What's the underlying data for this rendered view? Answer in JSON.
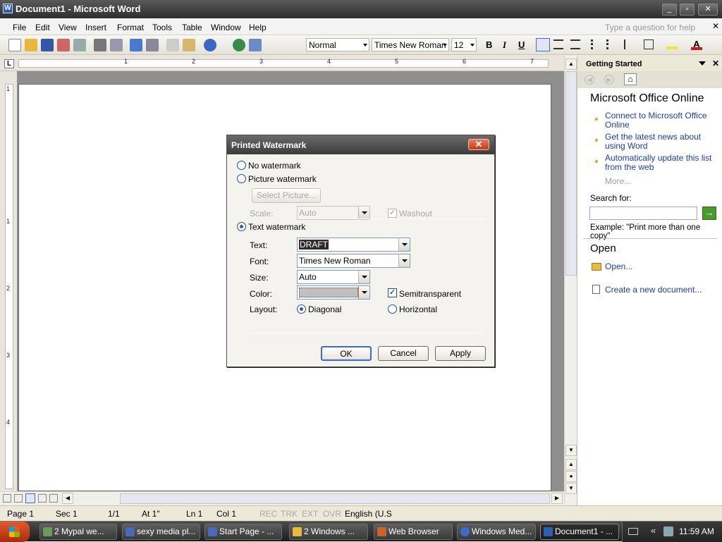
{
  "window": {
    "title": "Document1 - Microsoft Word",
    "icon": "word-doc-icon",
    "minimize": "_",
    "maximize": "▫",
    "close": "✕"
  },
  "menu": {
    "items": [
      "File",
      "Edit",
      "View",
      "Insert",
      "Format",
      "Tools",
      "Table",
      "Window",
      "Help"
    ],
    "help_placeholder": "Type a question for help"
  },
  "toolbar": {
    "style": "Normal",
    "font": "Times New Roman",
    "size": "12",
    "bold": "B",
    "italic": "I",
    "underline": "U"
  },
  "ruler": {
    "corner": "L",
    "numbers": [
      "1",
      "2",
      "3",
      "4",
      "5",
      "6",
      "7"
    ],
    "vertical_numbers": [
      "1",
      "1",
      "2",
      "3",
      "4"
    ]
  },
  "taskpane": {
    "title": "Getting Started",
    "heading_online": "Microsoft Office Online",
    "links": [
      "Connect to Microsoft Office Online",
      "Get the latest news about using Word",
      "Automatically update this list from the web"
    ],
    "more": "More...",
    "search_label": "Search for:",
    "search_value": "",
    "example": "Example:  \"Print more than one copy\"",
    "heading_open": "Open",
    "open_link": "Open...",
    "create_link": "Create a new document..."
  },
  "dialog": {
    "title": "Printed Watermark",
    "close": "✕",
    "no_watermark": "No watermark",
    "picture_watermark": "Picture watermark",
    "select_picture": "Select Picture...",
    "scale_label": "Scale:",
    "scale_value": "Auto",
    "washout": "Washout",
    "text_watermark": "Text watermark",
    "text_label": "Text:",
    "text_value": "DRAFT",
    "font_label": "Font:",
    "font_value": "Times New Roman",
    "size_label": "Size:",
    "size_value": "Auto",
    "color_label": "Color:",
    "semitransparent": "Semitransparent",
    "layout_label": "Layout:",
    "diagonal": "Diagonal",
    "horizontal": "Horizontal",
    "ok": "OK",
    "cancel": "Cancel",
    "apply": "Apply",
    "selected": "text_watermark",
    "layout_selected": "diagonal",
    "semitransparent_checked": true,
    "washout_checked": true
  },
  "status": {
    "page": "Page  1",
    "sec": "Sec  1",
    "pages": "1/1",
    "at": "At  1\"",
    "ln": "Ln  1",
    "col": "Col  1",
    "rec": "REC",
    "trk": "TRK",
    "ext": "EXT",
    "ovr": "OVR",
    "lang": "English (U.S"
  },
  "taskbar": {
    "tasks": [
      {
        "label": "2 Mypal we...",
        "icon": "browser-icon"
      },
      {
        "label": "sexy media pl...",
        "icon": "media-player-icon"
      },
      {
        "label": "Start Page - ...",
        "icon": "media-player-icon"
      },
      {
        "label": "2 Windows ...",
        "icon": "folder-icon"
      },
      {
        "label": "Web Browser",
        "icon": "browser-icon"
      },
      {
        "label": "Windows Med...",
        "icon": "media-player-icon"
      },
      {
        "label": "Document1 - ...",
        "icon": "word-doc-icon"
      }
    ],
    "clock": "11:59 AM"
  }
}
